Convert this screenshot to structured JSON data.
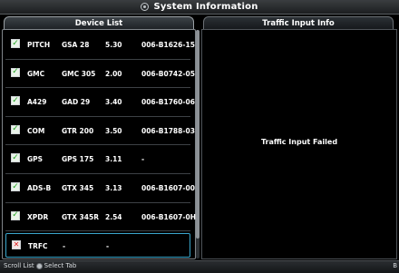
{
  "window": {
    "title": "System Information",
    "icon": "gear-icon"
  },
  "tabs": [
    {
      "label": "Device List",
      "active": true
    },
    {
      "label": "Traffic Input Info",
      "active": false
    }
  ],
  "devices": [
    {
      "name": "PITCH",
      "model": "GSA 28",
      "version": "5.30",
      "part": "006-B1626-15",
      "status": "ok"
    },
    {
      "name": "GMC",
      "model": "GMC 305",
      "version": "2.00",
      "part": "006-B0742-05",
      "status": "ok"
    },
    {
      "name": "A429",
      "model": "GAD 29",
      "version": "3.40",
      "part": "006-B1760-06",
      "status": "ok"
    },
    {
      "name": "COM",
      "model": "GTR 200",
      "version": "3.50",
      "part": "006-B1788-03",
      "status": "ok"
    },
    {
      "name": "GPS",
      "model": "GPS 175",
      "version": "3.11",
      "part": "-",
      "status": "ok"
    },
    {
      "name": "ADS-B",
      "model": "GTX 345",
      "version": "3.13",
      "part": "006-B1607-00",
      "status": "ok"
    },
    {
      "name": "XPDR",
      "model": "GTX 345R",
      "version": "2.54",
      "part": "006-B1607-0H",
      "status": "ok"
    },
    {
      "name": "TRFC",
      "model": "-",
      "version": "-",
      "part": "",
      "status": "fail"
    }
  ],
  "traffic_panel": {
    "message": "Traffic Input Failed"
  },
  "footer": {
    "scroll_label": "Scroll List",
    "select_label": "Select Tab",
    "right_text": "B"
  },
  "colors": {
    "ok": "#24a324",
    "fail": "#e02020",
    "selection": "#3aa6cc"
  }
}
